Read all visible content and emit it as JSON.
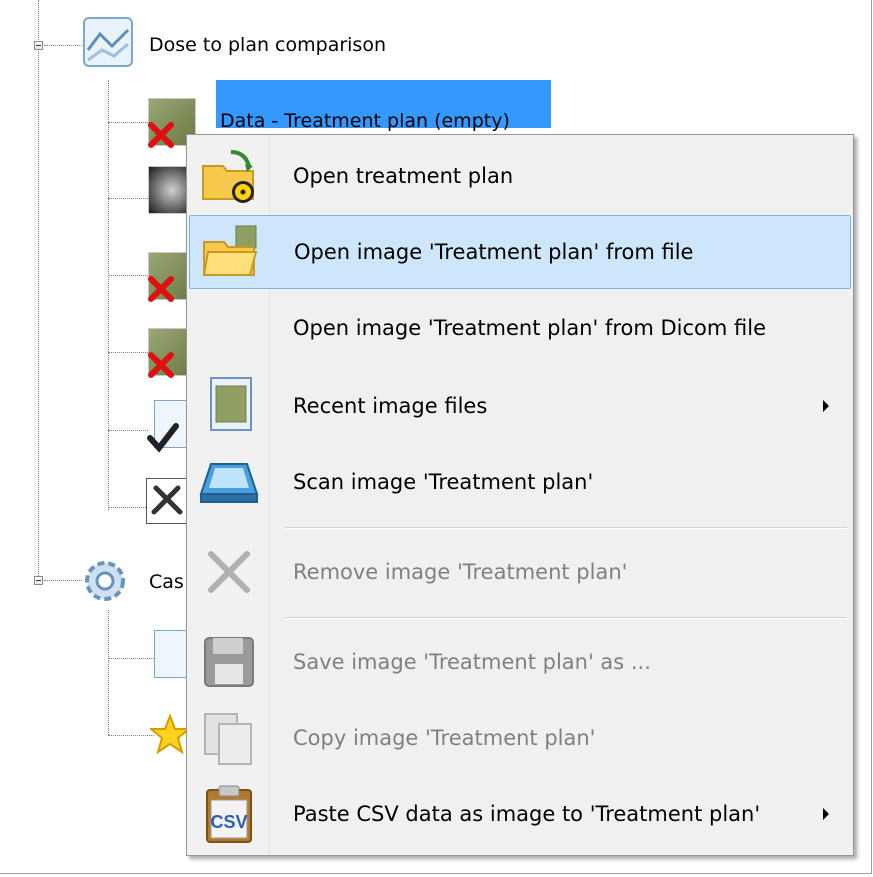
{
  "tree": {
    "dose_to_plan": "Dose to plan comparison",
    "selected_item": "Data - Treatment plan (empty)",
    "case_label": "Cas"
  },
  "menu": {
    "items": [
      {
        "label": "Open treatment plan",
        "icon": "folder-radiation-icon",
        "disabled": false
      },
      {
        "label": "Open image 'Treatment plan' from file",
        "icon": "open-folder-icon",
        "disabled": false
      },
      {
        "label": "Open image 'Treatment plan' from Dicom file",
        "icon": "",
        "disabled": false
      },
      {
        "label": "Recent image files",
        "icon": "image-file-icon",
        "disabled": false,
        "submenu": true
      },
      {
        "label": "Scan image 'Treatment plan'",
        "icon": "scanner-icon",
        "disabled": false
      },
      {
        "label": "Remove image 'Treatment plan'",
        "icon": "remove-icon",
        "disabled": true
      },
      {
        "label": "Save image 'Treatment plan' as ...",
        "icon": "floppy-disk-icon",
        "disabled": true
      },
      {
        "label": "Copy image 'Treatment plan'",
        "icon": "copy-icon",
        "disabled": true
      },
      {
        "label": "Paste CSV data as image to 'Treatment plan'",
        "icon": "csv-paste-icon",
        "disabled": false,
        "submenu": true
      }
    ]
  },
  "colors": {
    "selection": "#3399ff",
    "menu_hover": "#cde6fb",
    "disabled_text": "#808080"
  }
}
